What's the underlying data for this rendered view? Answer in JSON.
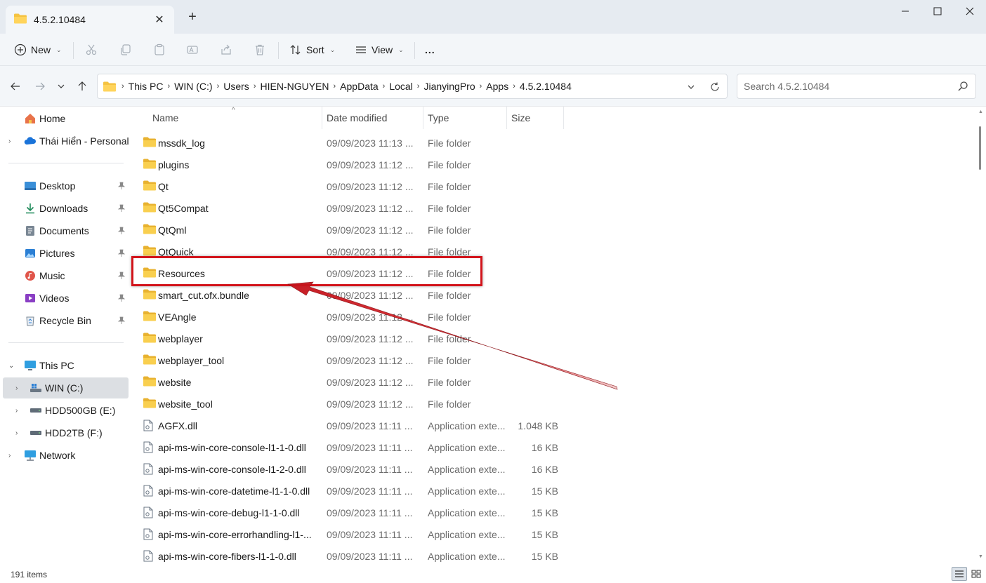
{
  "window": {
    "tab_title": "4.5.2.10484",
    "new_tab_label": "+"
  },
  "toolbar": {
    "new_label": "New",
    "sort_label": "Sort",
    "view_label": "View",
    "more_label": "..."
  },
  "address": {
    "crumbs": [
      "This PC",
      "WIN (C:)",
      "Users",
      "HIEN-NGUYEN",
      "AppData",
      "Local",
      "JianyingPro",
      "Apps",
      "4.5.2.10484"
    ],
    "search_placeholder": "Search 4.5.2.10484"
  },
  "sidebar": {
    "home": "Home",
    "onedrive": "Thái Hiển - Personal",
    "quick_access": [
      "Desktop",
      "Downloads",
      "Documents",
      "Pictures",
      "Music",
      "Videos",
      "Recycle Bin"
    ],
    "this_pc": "This PC",
    "drives": [
      "WIN (C:)",
      "HDD500GB (E:)",
      "HDD2TB (F:)"
    ],
    "network": "Network"
  },
  "columns": {
    "name": "Name",
    "date": "Date modified",
    "type": "Type",
    "size": "Size"
  },
  "files": [
    {
      "name": "mssdk_log",
      "date": "09/09/2023 11:13 ...",
      "type": "File folder",
      "size": "",
      "kind": "folder"
    },
    {
      "name": "plugins",
      "date": "09/09/2023 11:12 ...",
      "type": "File folder",
      "size": "",
      "kind": "folder"
    },
    {
      "name": "Qt",
      "date": "09/09/2023 11:12 ...",
      "type": "File folder",
      "size": "",
      "kind": "folder"
    },
    {
      "name": "Qt5Compat",
      "date": "09/09/2023 11:12 ...",
      "type": "File folder",
      "size": "",
      "kind": "folder"
    },
    {
      "name": "QtQml",
      "date": "09/09/2023 11:12 ...",
      "type": "File folder",
      "size": "",
      "kind": "folder"
    },
    {
      "name": "QtQuick",
      "date": "09/09/2023 11:12 ...",
      "type": "File folder",
      "size": "",
      "kind": "folder"
    },
    {
      "name": "Resources",
      "date": "09/09/2023 11:12 ...",
      "type": "File folder",
      "size": "",
      "kind": "folder"
    },
    {
      "name": "smart_cut.ofx.bundle",
      "date": "09/09/2023 11:12 ...",
      "type": "File folder",
      "size": "",
      "kind": "folder"
    },
    {
      "name": "VEAngle",
      "date": "09/09/2023 11:12 ...",
      "type": "File folder",
      "size": "",
      "kind": "folder"
    },
    {
      "name": "webplayer",
      "date": "09/09/2023 11:12 ...",
      "type": "File folder",
      "size": "",
      "kind": "folder"
    },
    {
      "name": "webplayer_tool",
      "date": "09/09/2023 11:12 ...",
      "type": "File folder",
      "size": "",
      "kind": "folder"
    },
    {
      "name": "website",
      "date": "09/09/2023 11:12 ...",
      "type": "File folder",
      "size": "",
      "kind": "folder"
    },
    {
      "name": "website_tool",
      "date": "09/09/2023 11:12 ...",
      "type": "File folder",
      "size": "",
      "kind": "folder"
    },
    {
      "name": "AGFX.dll",
      "date": "09/09/2023 11:11 ...",
      "type": "Application exte...",
      "size": "1.048 KB",
      "kind": "file"
    },
    {
      "name": "api-ms-win-core-console-l1-1-0.dll",
      "date": "09/09/2023 11:11 ...",
      "type": "Application exte...",
      "size": "16 KB",
      "kind": "file"
    },
    {
      "name": "api-ms-win-core-console-l1-2-0.dll",
      "date": "09/09/2023 11:11 ...",
      "type": "Application exte...",
      "size": "16 KB",
      "kind": "file"
    },
    {
      "name": "api-ms-win-core-datetime-l1-1-0.dll",
      "date": "09/09/2023 11:11 ...",
      "type": "Application exte...",
      "size": "15 KB",
      "kind": "file"
    },
    {
      "name": "api-ms-win-core-debug-l1-1-0.dll",
      "date": "09/09/2023 11:11 ...",
      "type": "Application exte...",
      "size": "15 KB",
      "kind": "file"
    },
    {
      "name": "api-ms-win-core-errorhandling-l1-...",
      "date": "09/09/2023 11:11 ...",
      "type": "Application exte...",
      "size": "15 KB",
      "kind": "file"
    },
    {
      "name": "api-ms-win-core-fibers-l1-1-0.dll",
      "date": "09/09/2023 11:11 ...",
      "type": "Application exte...",
      "size": "15 KB",
      "kind": "file"
    }
  ],
  "status": {
    "item_count": "191 items"
  },
  "colors": {
    "highlight": "#d2141b",
    "folder": "#f5c342",
    "accent": "#0067c0"
  }
}
